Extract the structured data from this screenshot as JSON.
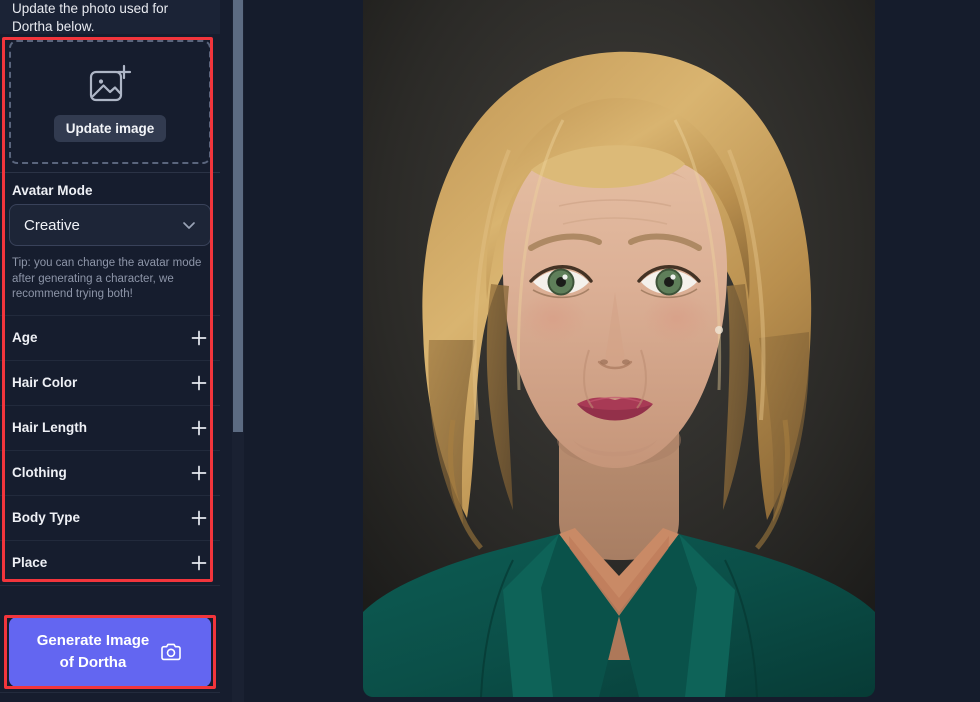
{
  "app": {
    "background_color": "#151c2c",
    "sidebar_background": "#161d2e",
    "accent_color": "#6366f1",
    "annotation_color": "#f2353c",
    "character_name": "Dortha"
  },
  "sidebar": {
    "intro_line_1": "Update the photo used for",
    "intro_line_2": "Dortha below.",
    "dropzone": {
      "icon": "image-plus-icon",
      "button_label": "Update image"
    },
    "avatar_mode": {
      "label": "Avatar Mode",
      "selected_value": "Creative",
      "chevron_icon": "chevron-down-icon",
      "tip_text": "Tip: you can change the avatar mode after generating a character, we recommend trying both!"
    },
    "accordion": {
      "expand_icon": "plus-icon",
      "items": [
        {
          "label": "Age"
        },
        {
          "label": "Hair Color"
        },
        {
          "label": "Hair Length"
        },
        {
          "label": "Clothing"
        },
        {
          "label": "Body Type"
        },
        {
          "label": "Place"
        }
      ]
    },
    "generate_button": {
      "line_1": "Generate Image",
      "line_2": "of Dortha",
      "icon": "camera-icon",
      "background_color": "#6366f1"
    },
    "scrollbar": {
      "name": "sidebar-scrollbar",
      "thumb_color": "#5c6b82"
    }
  },
  "preview": {
    "alt": "Portrait photograph of a middle-aged blonde woman in a dark green blazer against a dark grey studio backdrop"
  }
}
